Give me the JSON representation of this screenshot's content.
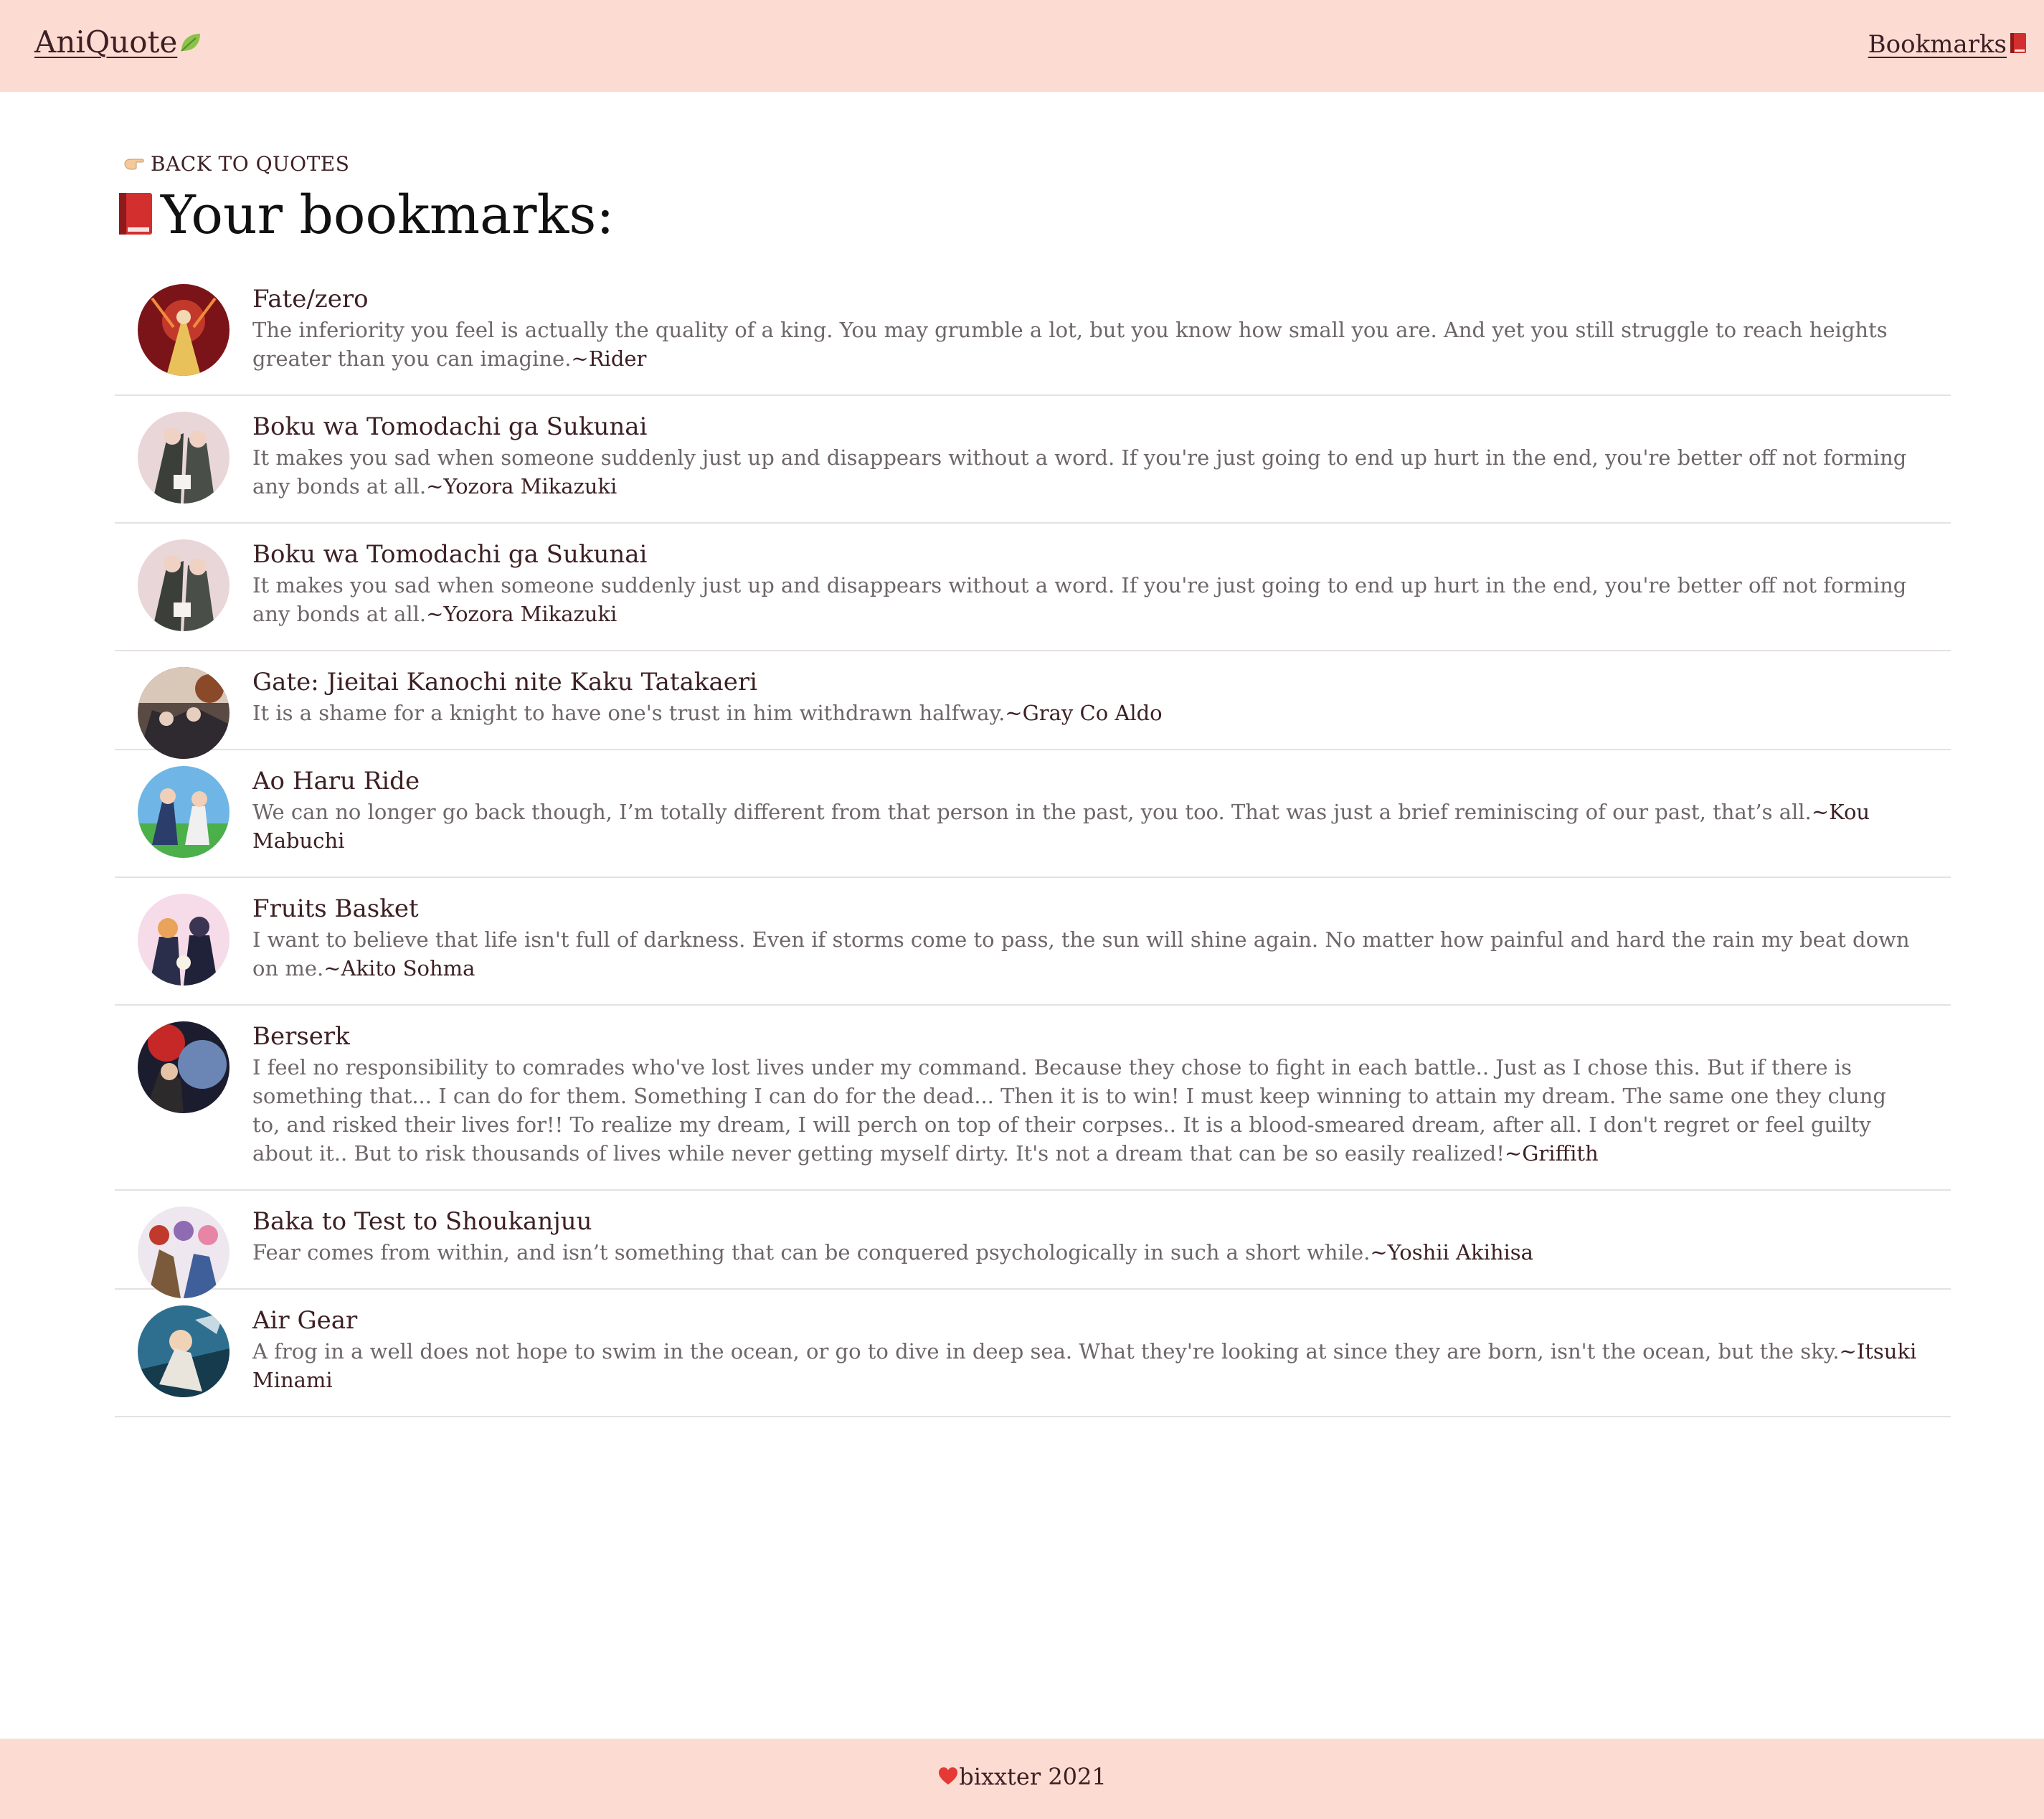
{
  "header": {
    "brand": "AniQuote",
    "brand_icon": "leaf-icon",
    "nav_bookmarks": "Bookmarks",
    "nav_icon": "red-book-icon"
  },
  "main": {
    "back_label": "BACK TO QUOTES",
    "back_icon": "pointing-hand-icon",
    "title": "Your bookmarks:",
    "title_icon": "red-book-icon"
  },
  "bookmarks": [
    {
      "anime": "Fate/zero",
      "quote": "The inferiority you feel is actually the quality of a king. You may grumble a lot, but you know how small you are. And yet you still struggle to reach heights greater than you can imagine.",
      "character": "~Rider"
    },
    {
      "anime": "Boku wa Tomodachi ga Sukunai",
      "quote": "It makes you sad when someone suddenly just up and disappears without a word. If you're just going to end up hurt in the end, you're better off not forming any bonds at all.",
      "character": "~Yozora Mikazuki"
    },
    {
      "anime": "Boku wa Tomodachi ga Sukunai",
      "quote": "It makes you sad when someone suddenly just up and disappears without a word. If you're just going to end up hurt in the end, you're better off not forming any bonds at all.",
      "character": "~Yozora Mikazuki"
    },
    {
      "anime": "Gate: Jieitai Kanochi nite Kaku Tatakaeri",
      "quote": "It is a shame for a knight to have one's trust in him withdrawn halfway.",
      "character": "~Gray Co Aldo"
    },
    {
      "anime": "Ao Haru Ride",
      "quote": "We can no longer go back though, I’m totally different from that person in the past, you too. That was just a brief reminiscing of our past, that’s all.",
      "character": "~Kou Mabuchi"
    },
    {
      "anime": "Fruits Basket",
      "quote": "I want to believe that life isn't full of darkness. Even if storms come to pass, the sun will shine again. No matter how painful and hard the rain my beat down on me.",
      "character": "~Akito Sohma"
    },
    {
      "anime": "Berserk",
      "quote": "I feel no responsibility to comrades who've lost lives under my command. Because they chose to fight in each battle.. Just as I chose this. But if there is something that... I can do for them. Something I can do for the dead... Then it is to win! I must keep winning to attain my dream. The same one they clung to, and risked their lives for!! To realize my dream, I will perch on top of their corpses.. It is a blood-smeared dream, after all. I don't regret or feel guilty about it.. But to risk thousands of lives while never getting myself dirty. It's not a dream that can be so easily realized!",
      "character": "~Griffith"
    },
    {
      "anime": "Baka to Test to Shoukanjuu",
      "quote": "Fear comes from within, and isn’t something that can be conquered psychologically in such a short while.",
      "character": "~Yoshii Akihisa"
    },
    {
      "anime": "Air Gear",
      "quote": "A frog in a well does not hope to swim in the ocean, or go to dive in deep sea. What they're looking at since they are born, isn't the ocean, but the sky.",
      "character": "~Itsuki Minami"
    }
  ],
  "footer": {
    "text": "bixxter 2021",
    "icon": "heart-icon"
  }
}
